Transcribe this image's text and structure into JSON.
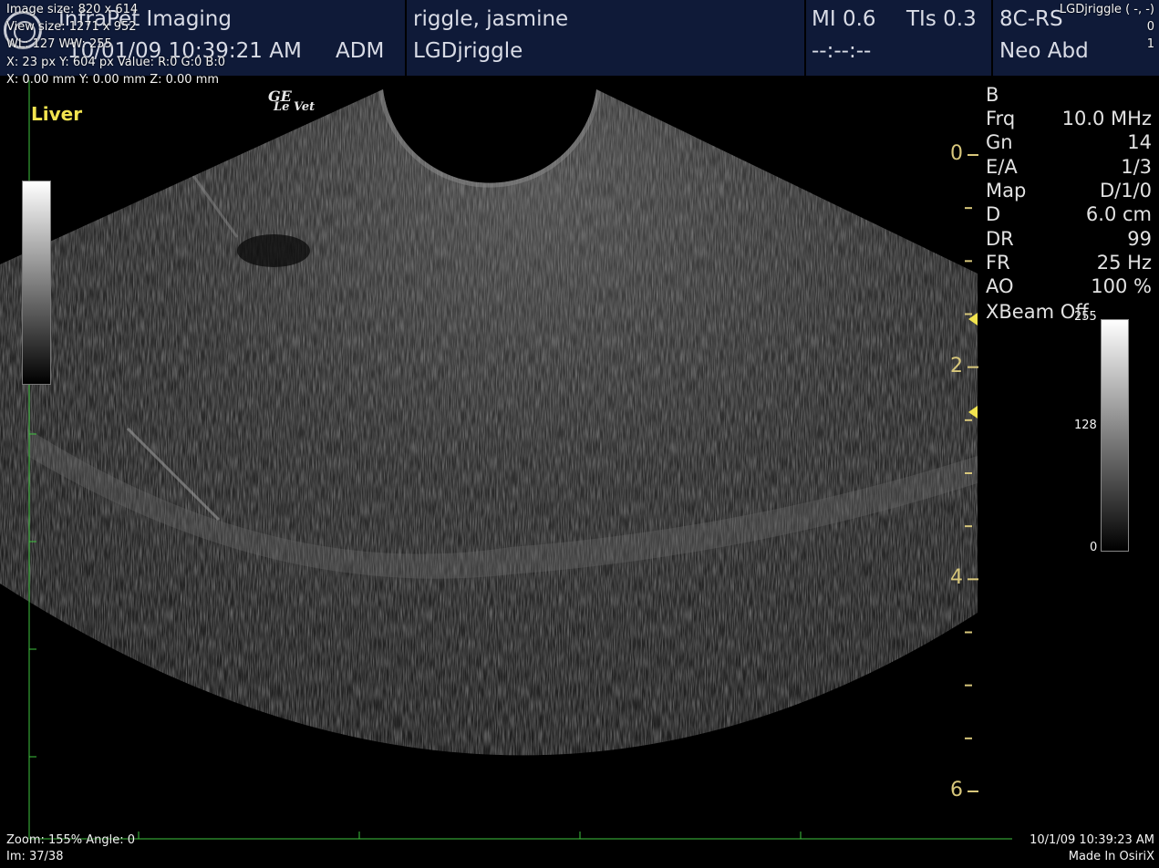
{
  "header": {
    "clinic": "InfraPet Imaging",
    "datetime": "10/01/09 10:39:21 AM",
    "operator": "ADM",
    "patient_name": "riggle, jasmine",
    "patient_id": "LGDjriggle",
    "mi": "MI 0.6",
    "tis": "TIs 0.3",
    "timer": "--:--:--",
    "probe": "8C-RS",
    "preset": "Neo Abd"
  },
  "overlay": {
    "image_size": "Image size: 820 x 614",
    "view_size": "View size: 1271 x 952",
    "wl_ww": "WL: 127 WW: 255",
    "pixel_info": "X: 23 px Y: 604 px Value: R:0 G:0 B:0",
    "mm_info": "X: 0.00 mm Y: 0.00 mm Z: 0.00 mm",
    "patient_corner": "LGDjriggle ( -, -)",
    "corner_0": "0",
    "corner_1": "1",
    "zoom": "Zoom: 155% Angle: 0",
    "image_index": "Im: 37/38",
    "study_datetime": "10/1/09 10:39:23 AM",
    "made_in": "Made In OsiriX"
  },
  "image": {
    "label": "Liver",
    "brand_top": "GE",
    "brand_bottom": "Le Vet"
  },
  "params": {
    "mode": "B",
    "rows": [
      {
        "key": "Frq",
        "value": "10.0 MHz"
      },
      {
        "key": "Gn",
        "value": "14"
      },
      {
        "key": "E/A",
        "value": "1/3"
      },
      {
        "key": "Map",
        "value": "D/1/0"
      },
      {
        "key": "D",
        "value": "6.0 cm"
      },
      {
        "key": "DR",
        "value": "99"
      },
      {
        "key": "FR",
        "value": "25 Hz"
      },
      {
        "key": "AO",
        "value": "100 %"
      }
    ],
    "xbeam": "XBeam Off"
  },
  "depth_scale": {
    "labels": [
      "0",
      "2",
      "4",
      "6"
    ],
    "unit_max_cm": 6
  },
  "colorbar": {
    "max": "255",
    "mid": "128",
    "min": "0"
  },
  "colors": {
    "header_bg": "#0f1a38",
    "label_yellow": "#f2e44f",
    "scale_tan": "#d8c77b",
    "crosshair_green": "#3ec43e"
  }
}
